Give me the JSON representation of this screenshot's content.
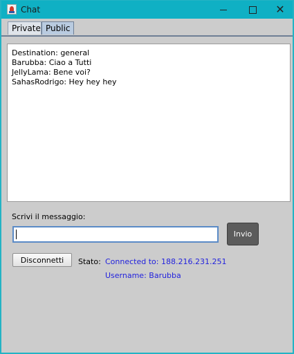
{
  "window": {
    "title": "Chat"
  },
  "tabs": [
    {
      "label": "Private"
    },
    {
      "label": "Public"
    }
  ],
  "chat": {
    "lines": [
      "Destination: general",
      "Barubba: Ciao a Tutti",
      "JellyLama: Bene voi?",
      "SahasRodrigo: Hey hey hey"
    ]
  },
  "compose": {
    "label": "Scrivi il messaggio:",
    "value": "",
    "send_label": "Invio"
  },
  "connection": {
    "disconnect_label": "Disconnetti",
    "status_label": "Stato:",
    "connected_text": "Connected to: 188.216.231.251",
    "username_text": "Username: Barubba"
  },
  "colors": {
    "titlebar": "#0fb0c4",
    "status_text": "#2222dd",
    "send_button": "#5c5c5c"
  }
}
